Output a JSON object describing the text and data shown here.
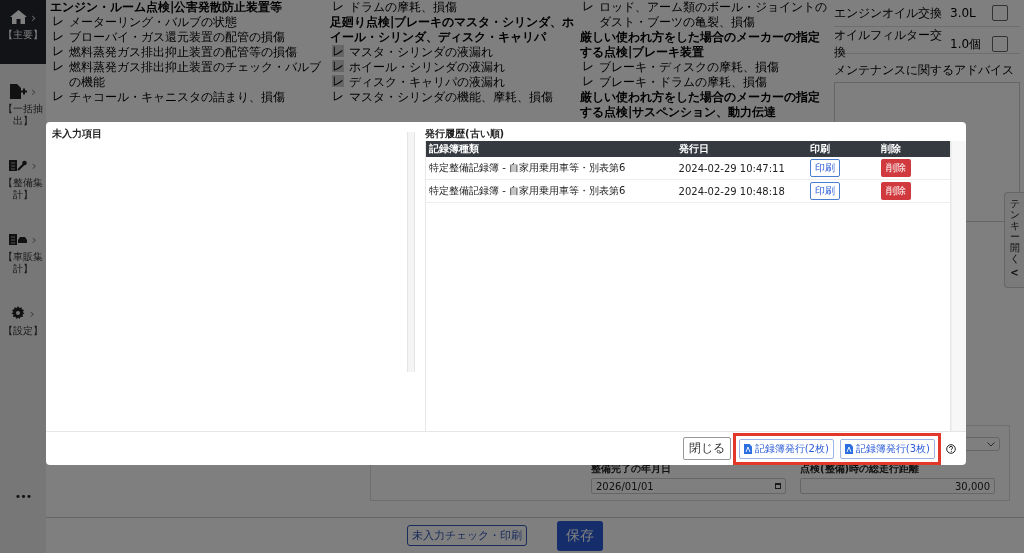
{
  "sidebar": {
    "items": [
      {
        "label": "【主要】",
        "arrow": "›",
        "selected": true
      },
      {
        "label": "【一括抽出】",
        "arrow": "›",
        "selected": false
      },
      {
        "label": "【整備集計】",
        "arrow": "›",
        "selected": false
      },
      {
        "label": "【車販集計】",
        "arrow": "›",
        "selected": false
      },
      {
        "label": "【設定】",
        "arrow": "›",
        "selected": false
      }
    ],
    "more": "•••"
  },
  "background": {
    "columns": [
      [
        {
          "kind": "heading",
          "text": "エンジン・ルーム点検|公害発散防止装置等"
        },
        {
          "kind": "item",
          "mark": "レ",
          "text": "メーターリング・バルブの状態",
          "boxed": false
        },
        {
          "kind": "item",
          "mark": "レ",
          "text": "ブローバイ・ガス還元装置の配管の損傷",
          "boxed": false
        },
        {
          "kind": "item",
          "mark": "レ",
          "text": "燃料蒸発ガス排出抑止装置の配管等の損傷",
          "boxed": false
        },
        {
          "kind": "item",
          "mark": "レ",
          "text": "燃料蒸発ガス排出抑止装置のチェック・バルブの機能",
          "boxed": false
        },
        {
          "kind": "item",
          "mark": "レ",
          "text": "チャコール・キャニスタの詰まり、損傷",
          "boxed": false
        }
      ],
      [
        {
          "kind": "item",
          "mark": "レ",
          "text": "ドラムの摩耗、損傷",
          "boxed": false
        },
        {
          "kind": "heading",
          "text": "足廻り点検|ブレーキのマスタ・シリンダ、ホイール・シリンダ、ディスク・キャリパ"
        },
        {
          "kind": "item",
          "mark": "レ",
          "text": "マスタ・シリンダの液漏れ",
          "boxed": true
        },
        {
          "kind": "item",
          "mark": "レ",
          "text": "ホイール・シリンダの液漏れ",
          "boxed": true
        },
        {
          "kind": "item",
          "mark": "レ",
          "text": "ディスク・キャリパの液漏れ",
          "boxed": true
        },
        {
          "kind": "item",
          "mark": "レ",
          "text": "マスタ・シリンダの機能、摩耗、損傷",
          "boxed": false
        }
      ],
      [
        {
          "kind": "item",
          "mark": "レ",
          "text": "ロッド、アーム類のボール・ジョイントのダスト・ブーツの亀裂、損傷",
          "boxed": false
        },
        {
          "kind": "heading",
          "text": "厳しい使われ方をした場合のメーカーの指定する点検|ブレーキ装置"
        },
        {
          "kind": "item",
          "mark": "レ",
          "text": "ブレーキ・ディスクの摩耗、損傷",
          "boxed": false
        },
        {
          "kind": "item",
          "mark": "レ",
          "text": "ブレーキ・ドラムの摩耗、損傷",
          "boxed": false
        },
        {
          "kind": "heading",
          "text": "厳しい使われ方をした場合のメーカーの指定する点検|サスペンション、動力伝達"
        }
      ]
    ],
    "parts": [
      {
        "name": "エンジンオイル交換",
        "amount": "3.0L",
        "checked": false
      },
      {
        "name": "オイルフィルター交換",
        "amount": "1.0個",
        "checked": false
      }
    ],
    "advice_label": "メンテナンスに関するアドバイス",
    "fields": [
      {
        "label": "整備完了の年月日",
        "value": "2026/01/01",
        "kind": "date"
      },
      {
        "label": "点検(整備)時の総走行距離",
        "value": "30,000",
        "kind": "number"
      }
    ],
    "tenkey_tab": {
      "label": "テンキー開く",
      "arrow": "<"
    }
  },
  "modal": {
    "left_title": "未入力項目",
    "right_title": "発行履歴(古い順)",
    "columns": [
      "記録簿種類",
      "発行日",
      "印刷",
      "削除"
    ],
    "rows": [
      {
        "type": "特定整備記録簿 - 自家用乗用車等・別表第6",
        "date": "2024-02-29 10:47:11",
        "print": "印刷",
        "delete": "削除"
      },
      {
        "type": "特定整備記録簿 - 自家用乗用車等・別表第6",
        "date": "2024-02-29 10:48:18",
        "print": "印刷",
        "delete": "削除"
      }
    ],
    "footer_buttons": [
      {
        "label": "閉じる",
        "kind": "close"
      },
      {
        "label": "記録簿発行(2枚)",
        "kind": "pdf"
      },
      {
        "label": "記録簿発行(3枚)",
        "kind": "pdf"
      }
    ]
  },
  "bottom_bar": {
    "buttons": [
      {
        "label": "未入力チェック・印刷",
        "kind": "outline"
      },
      {
        "label": "保存",
        "kind": "primary"
      }
    ]
  }
}
